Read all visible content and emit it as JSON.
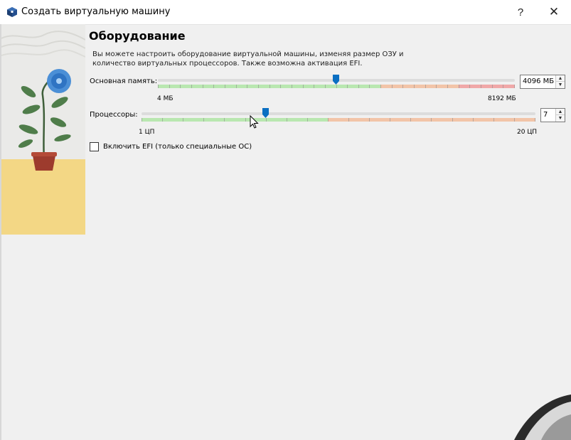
{
  "window": {
    "title": "Создать виртуальную машину",
    "help_label": "?",
    "close_label": "✕",
    "app_icon": "virtualbox-icon"
  },
  "page": {
    "heading": "Оборудование",
    "description": "Вы можете настроить оборудование виртуальной машины, изменяя размер ОЗУ и количество виртуальных процессоров. Также возможна активация EFI."
  },
  "memory": {
    "label": "Основная память:",
    "min_label": "4 МБ",
    "max_label": "8192 МБ",
    "value_text": "4096 МБ",
    "value": 4096,
    "min": 4,
    "max": 8192
  },
  "processors": {
    "label": "Процессоры:",
    "min_label": "1 ЦП",
    "max_label": "20 ЦП",
    "value_text": "7",
    "value": 7,
    "min": 1,
    "max": 20
  },
  "efi": {
    "label": "Включить EFI (только специальные ОС)",
    "checked": false
  },
  "colors": {
    "accent": "#0a6fc2",
    "green_band": "#b9e7b0",
    "orange_band": "#f2c4a8",
    "red_band": "#f0a8a8",
    "art_sand": "#f3d785",
    "art_sky": "#e9efe9"
  }
}
